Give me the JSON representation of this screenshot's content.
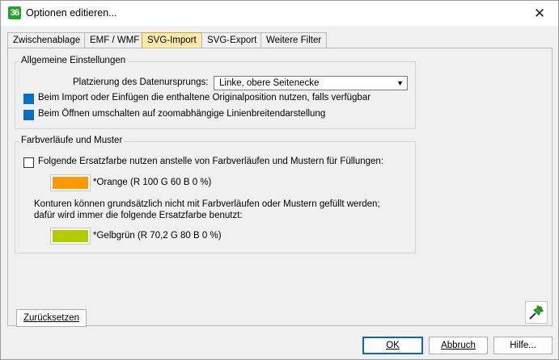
{
  "window": {
    "title": "Optionen editieren...",
    "app_icon_text": "36",
    "close_glyph": "✕",
    "accent_color": "#23a52a"
  },
  "tabs": [
    {
      "label": "Zwischenablage",
      "active": false
    },
    {
      "label": "EMF / WMF",
      "active": false
    },
    {
      "label": "SVG-Import",
      "active": true
    },
    {
      "label": "SVG-Export",
      "active": false
    },
    {
      "label": "Weitere Filter",
      "active": false
    }
  ],
  "general": {
    "title": "Allgemeine Einstellungen",
    "origin_label": "Platzierung des Datenursprungs:",
    "origin_value": "Linke, obere Seitenecke",
    "option1_label": "Beim Import oder Einfügen die enthaltene Originalposition nutzen, falls verfügbar",
    "option1_checked": true,
    "option2_label": "Beim Öffnen umschalten auf zoomabhängige Linienbreitendarstellung",
    "option2_checked": true
  },
  "gradients": {
    "title": "Farbverläufe und Muster",
    "replace_label": "Folgende Ersatzfarbe nutzen anstelle von Farbverläufen und Mustern für Füllungen:",
    "replace_checked": false,
    "fill_color_name": "*Orange (R 100 G 60 B 0 %)",
    "fill_color": "#ff9900",
    "contour_note_line1": "Konturen können grundsätzlich nicht mit Farbverläufen oder Mustern gefüllt werden;",
    "contour_note_line2": "dafür wird immer die folgende Ersatzfarbe benutzt:",
    "contour_color_name": "*Gelbgrün (R 70,2 G 80 B 0 %)",
    "contour_color": "#b3cc00"
  },
  "buttons": {
    "reset": "Zurücksetzen",
    "ok": "OK",
    "cancel": "Abbruch",
    "help": "Hilfe..."
  }
}
